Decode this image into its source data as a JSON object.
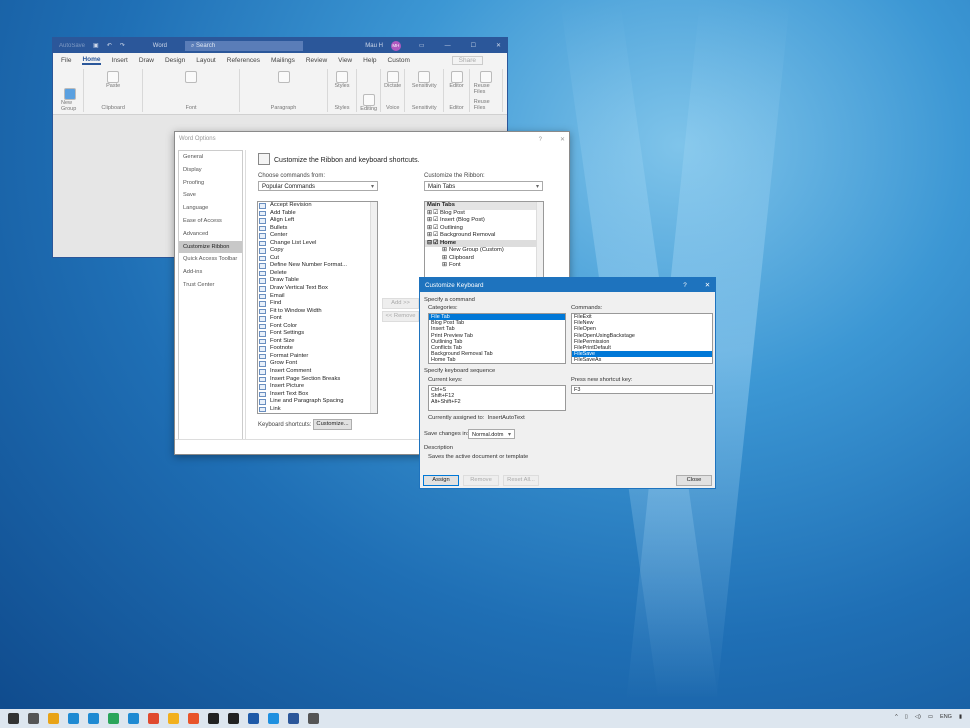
{
  "word": {
    "autosave": "AutoSave",
    "app": "Word",
    "search_placeholder": "Search",
    "user": "Mau H",
    "initials": "MH",
    "tabs": [
      "File",
      "Home",
      "Insert",
      "Draw",
      "Design",
      "Layout",
      "References",
      "Mailings",
      "Review",
      "View",
      "Help",
      "Custom"
    ],
    "share": "Share",
    "groups": [
      {
        "label": "New Group",
        "btn": "New Group"
      },
      {
        "label": "Clipboard",
        "btn": "Paste"
      },
      {
        "label": "Font",
        "btn": ""
      },
      {
        "label": "Paragraph",
        "btn": ""
      },
      {
        "label": "Styles",
        "btn": "Styles"
      },
      {
        "label": "",
        "btn": "Editing"
      },
      {
        "label": "Voice",
        "btn": "Dictate"
      },
      {
        "label": "Sensitivity",
        "btn": "Sensitivity"
      },
      {
        "label": "Editor",
        "btn": "Editor"
      },
      {
        "label": "Reuse Files",
        "btn": "Reuse Files"
      }
    ]
  },
  "options": {
    "title": "Word Options",
    "help": "?",
    "close": "✕",
    "nav": [
      "General",
      "Display",
      "Proofing",
      "Save",
      "Language",
      "Ease of Access",
      "Advanced",
      "Customize Ribbon",
      "Quick Access Toolbar",
      "Add-ins",
      "Trust Center"
    ],
    "heading": "Customize the Ribbon and keyboard shortcuts.",
    "choose_label": "Choose commands from:",
    "choose_value": "Popular Commands",
    "ribbon_label": "Customize the Ribbon:",
    "ribbon_value": "Main Tabs",
    "commands": [
      "Accept Revision",
      "Add Table",
      "Align Left",
      "Bullets",
      "Center",
      "Change List Level",
      "Copy",
      "Cut",
      "Define New Number Format...",
      "Delete",
      "Draw Table",
      "Draw Vertical Text Box",
      "Email",
      "Find",
      "Fit to Window Width",
      "Font",
      "Font Color",
      "Font Settings",
      "Font Size",
      "Footnote",
      "Format Painter",
      "Grow Font",
      "Insert Comment",
      "Insert Page  Section Breaks",
      "Insert Picture",
      "Insert Text Box",
      "Line and Paragraph Spacing",
      "Link"
    ],
    "tree_header": "Main Tabs",
    "tree": [
      "Blog Post",
      "Insert (Blog Post)",
      "Outlining",
      "Background Removal",
      "Home"
    ],
    "home_children": [
      "New Group (Custom)",
      "Clipboard",
      "Font"
    ],
    "add": "Add >>",
    "remove": "<< Remove",
    "shortcuts_label": "Keyboard shortcuts:",
    "customize": "Customize..."
  },
  "keyboard": {
    "title": "Customize Keyboard",
    "help": "?",
    "close_x": "✕",
    "specify_command": "Specify a command",
    "categories_label": "Categories:",
    "categories": [
      "File Tab",
      "Blog Post Tab",
      "Insert Tab",
      "Print Preview Tab",
      "Outlining Tab",
      "Conflicts Tab",
      "Background Removal Tab",
      "Home Tab"
    ],
    "commands_label": "Commands:",
    "commands": [
      "FileExit",
      "FileNew",
      "FileOpen",
      "FileOpenUsingBackstage",
      "FilePermission",
      "FilePrintDefault",
      "FileSave",
      "FileSaveAs"
    ],
    "specify_seq": "Specify keyboard sequence",
    "current_keys_label": "Current keys:",
    "current_keys": [
      "Ctrl+S",
      "Shift+F12",
      "Alt+Shift+F2"
    ],
    "new_key_label": "Press new shortcut key:",
    "new_key": "F3",
    "assigned_label": "Currently assigned to:",
    "assigned_value": "InsertAutoText",
    "save_label": "Save changes in:",
    "save_value": "Normal.dotm",
    "desc_label": "Description",
    "desc": "Saves the active document or template",
    "assign": "Assign",
    "remove": "Remove",
    "reset": "Reset All...",
    "close": "Close"
  },
  "taskbar": {
    "lang": "ENG",
    "icon_colors": [
      "#333",
      "#555",
      "#e8a317",
      "#1f8ad2",
      "#1f8ad2",
      "#2aa55a",
      "#1f8ad2",
      "#e04a2f",
      "#f2b01e",
      "#e8542a",
      "#222",
      "#222",
      "#1e5aa8",
      "#1e90e0",
      "#2b579a",
      "#555"
    ]
  }
}
